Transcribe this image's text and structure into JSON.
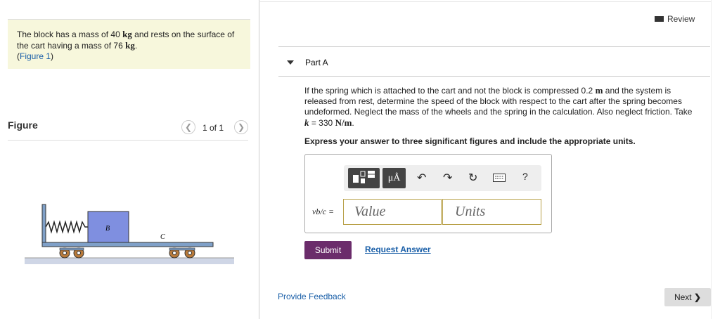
{
  "problem": {
    "text1": "The block has a mass of 40",
    "unit1": "kg",
    "text2": "and rests on the surface of the cart having a mass of 76",
    "unit2": "kg",
    "text3": ".",
    "figure_link_prefix": "(",
    "figure_link": "Figure 1",
    "figure_link_suffix": ")"
  },
  "figure": {
    "heading": "Figure",
    "pager": "1 of 1",
    "prev_icon": "chevron-left-icon",
    "next_icon": "chevron-right-icon",
    "label_b": "B",
    "label_c": "C",
    "colors": {
      "cart": "#7fa0c8",
      "block": "#7f8fe0",
      "wheel": "#b87a3a",
      "ground": "#cfd6e6"
    }
  },
  "header": {
    "review": "Review"
  },
  "part": {
    "label": "Part A",
    "question_l1a": "If the spring which is attached to the cart and not the block is compressed 0.2",
    "question_l1_unit": "m",
    "question_l1b": "and the system is",
    "question_l2": "released from rest, determine the speed of the block with respect to the cart after the spring becomes",
    "question_l3": "undeformed. Neglect the mass of the wheels and the spring in the calculation. Also neglect friction. Take",
    "k_symbol": "k",
    "k_value": "= 330",
    "k_unit": "N/m",
    "k_end": ".",
    "instruction": "Express your answer to three significant figures and include the appropriate units."
  },
  "answer": {
    "var_label": "vb/c =",
    "value_placeholder": "Value",
    "units_placeholder": "Units",
    "toolbar": {
      "templates_icon": "templates-icon",
      "units_label": "μÅ",
      "undo_icon": "undo-icon",
      "redo_icon": "redo-icon",
      "reset_icon": "reset-icon",
      "keyboard_icon": "keyboard-icon",
      "help_label": "?"
    }
  },
  "actions": {
    "submit": "Submit",
    "request_answer": "Request Answer",
    "provide_feedback": "Provide Feedback",
    "next": "Next"
  }
}
